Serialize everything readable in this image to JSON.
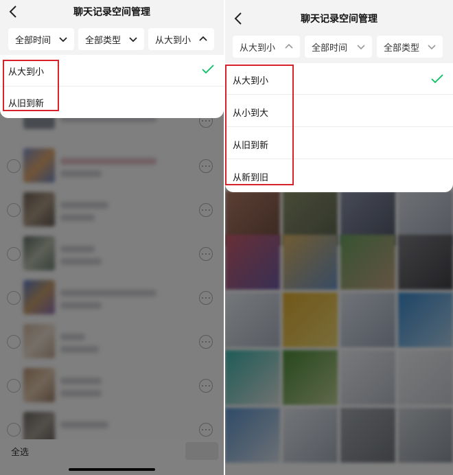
{
  "left": {
    "title": "聊天记录空间管理",
    "filters": [
      "全部时间",
      "全部类型",
      "从大到小"
    ],
    "dropdown": [
      "从大到小",
      "从旧到新"
    ],
    "bottom": {
      "select_all": "全选"
    }
  },
  "right": {
    "title": "聊天记录空间管理",
    "filters": [
      "从大到小",
      "全部时间",
      "全部类型"
    ],
    "dropdown": [
      "从大到小",
      "从小到大",
      "从旧到新",
      "从新到旧"
    ]
  },
  "colors": {
    "check": "#07c160",
    "highlight": "#d6202a"
  }
}
